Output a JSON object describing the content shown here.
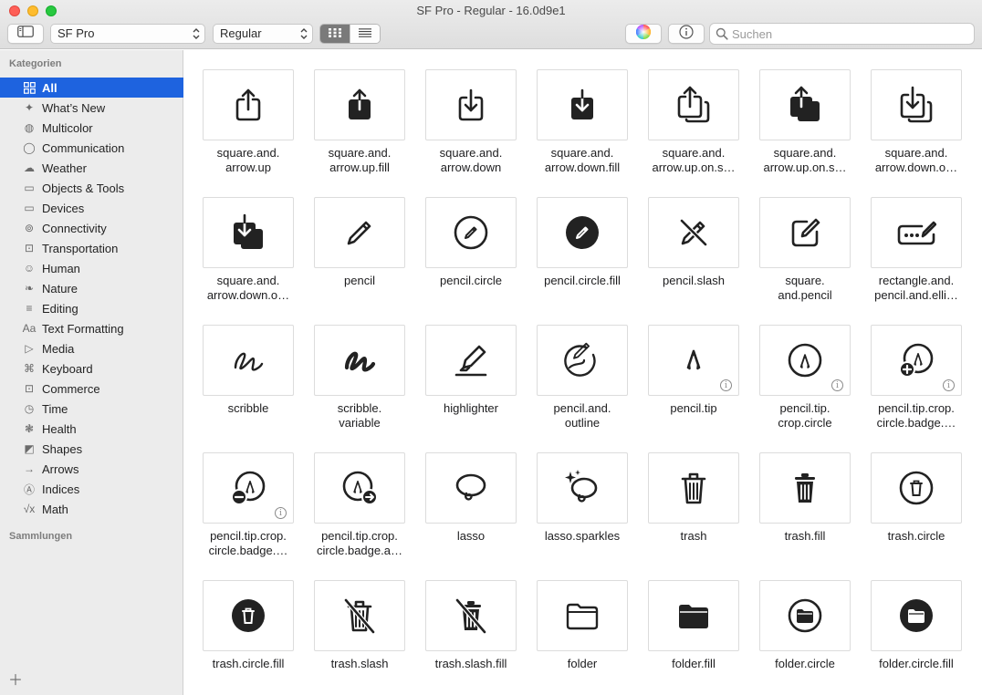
{
  "window": {
    "title": "SF Pro - Regular - 16.0d9e1"
  },
  "toolbar": {
    "font_value": "SF Pro",
    "weight_value": "Regular",
    "search_placeholder": "Suchen"
  },
  "sidebar": {
    "categories_heading": "Kategorien",
    "collections_heading": "Sammlungen",
    "items": [
      {
        "label": "All",
        "icon": "grid-icon"
      },
      {
        "label": "What’s New",
        "icon": "sparkle-icon"
      },
      {
        "label": "Multicolor",
        "icon": "palette-icon"
      },
      {
        "label": "Communication",
        "icon": "bubble-icon"
      },
      {
        "label": "Weather",
        "icon": "cloud-icon"
      },
      {
        "label": "Objects & Tools",
        "icon": "folder-icon"
      },
      {
        "label": "Devices",
        "icon": "display-icon"
      },
      {
        "label": "Connectivity",
        "icon": "antenna-icon"
      },
      {
        "label": "Transportation",
        "icon": "car-icon"
      },
      {
        "label": "Human",
        "icon": "person-icon"
      },
      {
        "label": "Nature",
        "icon": "leaf-icon"
      },
      {
        "label": "Editing",
        "icon": "sliders-icon"
      },
      {
        "label": "Text Formatting",
        "icon": "textformat-icon"
      },
      {
        "label": "Media",
        "icon": "playpause-icon"
      },
      {
        "label": "Keyboard",
        "icon": "command-icon"
      },
      {
        "label": "Commerce",
        "icon": "cart-icon"
      },
      {
        "label": "Time",
        "icon": "clock-icon"
      },
      {
        "label": "Health",
        "icon": "heart-icon"
      },
      {
        "label": "Shapes",
        "icon": "shapes-icon"
      },
      {
        "label": "Arrows",
        "icon": "arrow-icon"
      },
      {
        "label": "Indices",
        "icon": "indices-icon"
      },
      {
        "label": "Math",
        "icon": "sqrt-icon"
      }
    ]
  },
  "symbols": [
    {
      "label": "square.and.\narrow.up",
      "icon": "square-arrow-up",
      "info": false
    },
    {
      "label": "square.and.\narrow.up.fill",
      "icon": "square-arrow-up-fill",
      "info": false
    },
    {
      "label": "square.and.\narrow.down",
      "icon": "square-arrow-down",
      "info": false
    },
    {
      "label": "square.and.\narrow.down.fill",
      "icon": "square-arrow-down-fill",
      "info": false
    },
    {
      "label": "square.and.\narrow.up.on.s…",
      "icon": "square-arrow-up-on-square",
      "info": false
    },
    {
      "label": "square.and.\narrow.up.on.s…",
      "icon": "square-arrow-up-on-square-fill",
      "info": false
    },
    {
      "label": "square.and.\narrow.down.o…",
      "icon": "square-arrow-down-on-square",
      "info": false
    },
    {
      "label": "square.and.\narrow.down.o…",
      "icon": "square-arrow-down-on-square-fill",
      "info": false
    },
    {
      "label": "pencil",
      "icon": "pencil",
      "info": false
    },
    {
      "label": "pencil.circle",
      "icon": "pencil-circle",
      "info": false
    },
    {
      "label": "pencil.circle.fill",
      "icon": "pencil-circle-fill",
      "info": false
    },
    {
      "label": "pencil.slash",
      "icon": "pencil-slash",
      "info": false
    },
    {
      "label": "square.\nand.pencil",
      "icon": "square-and-pencil",
      "info": false
    },
    {
      "label": "rectangle.and.\npencil.and.elli…",
      "icon": "rectangle-pencil-ellipsis",
      "info": false
    },
    {
      "label": "scribble",
      "icon": "scribble",
      "info": false
    },
    {
      "label": "scribble.\nvariable",
      "icon": "scribble-variable",
      "info": false
    },
    {
      "label": "highlighter",
      "icon": "highlighter",
      "info": false
    },
    {
      "label": "pencil.and.\noutline",
      "icon": "pencil-and-outline",
      "info": false
    },
    {
      "label": "pencil.tip",
      "icon": "pencil-tip",
      "info": true
    },
    {
      "label": "pencil.tip.\ncrop.circle",
      "icon": "pencil-tip-crop-circle",
      "info": true
    },
    {
      "label": "pencil.tip.crop.\ncircle.badge.…",
      "icon": "pencil-tip-crop-circle-badge-plus",
      "info": true
    },
    {
      "label": "pencil.tip.crop.\ncircle.badge.…",
      "icon": "pencil-tip-crop-circle-badge-minus",
      "info": true
    },
    {
      "label": "pencil.tip.crop.\ncircle.badge.a…",
      "icon": "pencil-tip-crop-circle-badge-arrow",
      "info": false
    },
    {
      "label": "lasso",
      "icon": "lasso",
      "info": false
    },
    {
      "label": "lasso.sparkles",
      "icon": "lasso-sparkles",
      "info": false
    },
    {
      "label": "trash",
      "icon": "trash",
      "info": false
    },
    {
      "label": "trash.fill",
      "icon": "trash-fill",
      "info": false
    },
    {
      "label": "trash.circle",
      "icon": "trash-circle",
      "info": false
    },
    {
      "label": "trash.circle.fill",
      "icon": "trash-circle-fill",
      "info": false
    },
    {
      "label": "trash.slash",
      "icon": "trash-slash",
      "info": false
    },
    {
      "label": "trash.slash.fill",
      "icon": "trash-slash-fill",
      "info": false
    },
    {
      "label": "folder",
      "icon": "folder",
      "info": false
    },
    {
      "label": "folder.fill",
      "icon": "folder-fill",
      "info": false
    },
    {
      "label": "folder.circle",
      "icon": "folder-circle",
      "info": false
    },
    {
      "label": "folder.circle.fill",
      "icon": "folder-circle-fill",
      "info": false
    }
  ]
}
